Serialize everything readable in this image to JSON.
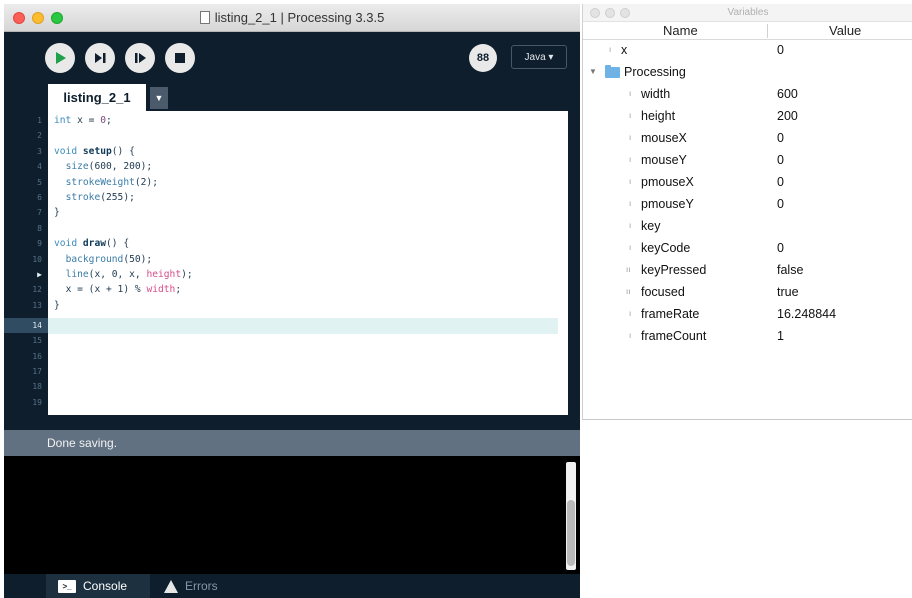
{
  "ide": {
    "window_title": "listing_2_1 | Processing 3.3.5",
    "tab_label": "listing_2_1",
    "tab_menu_glyph": "▼",
    "mode_label": "Java ▾",
    "debug_glyph": "88",
    "status_message": "Done saving.",
    "bottom_tabs": {
      "console": "Console",
      "errors": "Errors"
    },
    "console_icon_glyph": ">_",
    "line_numbers": [
      "1",
      "2",
      "3",
      "4",
      "5",
      "6",
      "7",
      "8",
      "9",
      "10",
      "▶",
      "12",
      "13",
      "14",
      "15",
      "16",
      "17",
      "18",
      "19"
    ],
    "active_line": "14",
    "icons": [
      "run-icon",
      "step-icon",
      "continue-icon",
      "stop-icon",
      "debug-icon",
      "console-icon",
      "warning-icon"
    ]
  },
  "code": {
    "l1_kw": "int",
    "l1_rest": " x = ",
    "l1_num": "0",
    "l1_end": ";",
    "l3_kw": "void",
    "l3_fn": "setup",
    "l3_rest": "() {",
    "l4_call": "size",
    "l4_rest": "(600, 200);",
    "l5_call": "strokeWeight",
    "l5_rest": "(2);",
    "l6_call": "stroke",
    "l6_rest": "(255);",
    "l7": "}",
    "l9_kw": "void",
    "l9_fn": "draw",
    "l9_rest": "() {",
    "l10_call": "background",
    "l10_rest": "(50);",
    "l11_call": "line",
    "l11_rest": "(x, 0, x, ",
    "l11_pink": "height",
    "l11_end": ");",
    "l12_rest": "x = (x + 1) % ",
    "l12_pink": "width",
    "l12_end": ";",
    "l13": "}"
  },
  "variables": {
    "window_title": "Variables",
    "col_name": "Name",
    "col_value": "Value",
    "rows": [
      {
        "name": "x",
        "value": "0"
      },
      {
        "name": "Processing",
        "value": ""
      },
      {
        "name": "width",
        "value": "600"
      },
      {
        "name": "height",
        "value": "200"
      },
      {
        "name": "mouseX",
        "value": "0"
      },
      {
        "name": "mouseY",
        "value": "0"
      },
      {
        "name": "pmouseX",
        "value": "0"
      },
      {
        "name": "pmouseY",
        "value": "0"
      },
      {
        "name": "key",
        "value": ""
      },
      {
        "name": "keyCode",
        "value": "0"
      },
      {
        "name": "keyPressed",
        "value": "false"
      },
      {
        "name": "focused",
        "value": "true"
      },
      {
        "name": "frameRate",
        "value": "16.248844"
      },
      {
        "name": "frameCount",
        "value": "1"
      }
    ]
  }
}
